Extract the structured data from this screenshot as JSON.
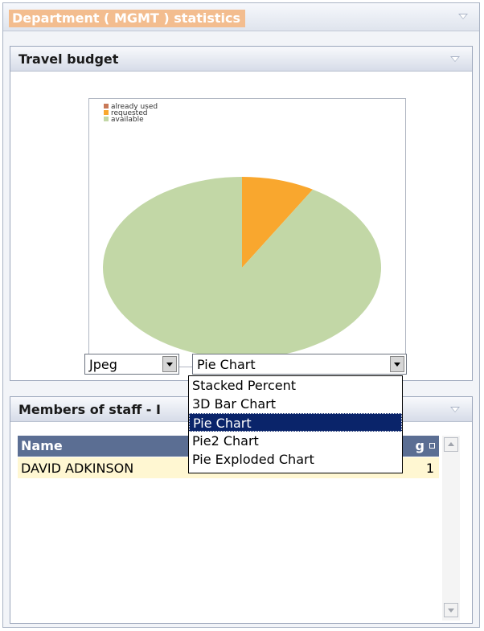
{
  "outer": {
    "title": "Department ( MGMT ) statistics"
  },
  "travel_panel": {
    "title": "Travel budget"
  },
  "chart": {
    "legend": [
      {
        "label": "already used",
        "color": "#c87958"
      },
      {
        "label": "requested",
        "color": "#f9a72e"
      },
      {
        "label": "available",
        "color": "#c2d7a6"
      }
    ]
  },
  "chart_data": {
    "type": "pie",
    "categories": [
      "already used",
      "requested",
      "available"
    ],
    "values": [
      0,
      8.5,
      91.5
    ],
    "colors": [
      "#c87958",
      "#f9a72e",
      "#c2d7a6"
    ],
    "legend_position": "top-left"
  },
  "controls": {
    "format_select": {
      "value": "Jpeg"
    },
    "type_select": {
      "value": "Pie Chart"
    }
  },
  "dropdown": {
    "options": [
      "Stacked Percent",
      "3D Bar Chart",
      "Pie Chart",
      "Pie2 Chart",
      "Pie Exploded Chart"
    ],
    "selected": "Pie Chart"
  },
  "staff_panel": {
    "title": "Members of staff - I"
  },
  "staff_table": {
    "headers": {
      "name": "Name",
      "right": "g"
    },
    "rows": [
      {
        "name": "DAVID ADKINSON",
        "value": "1"
      }
    ]
  }
}
